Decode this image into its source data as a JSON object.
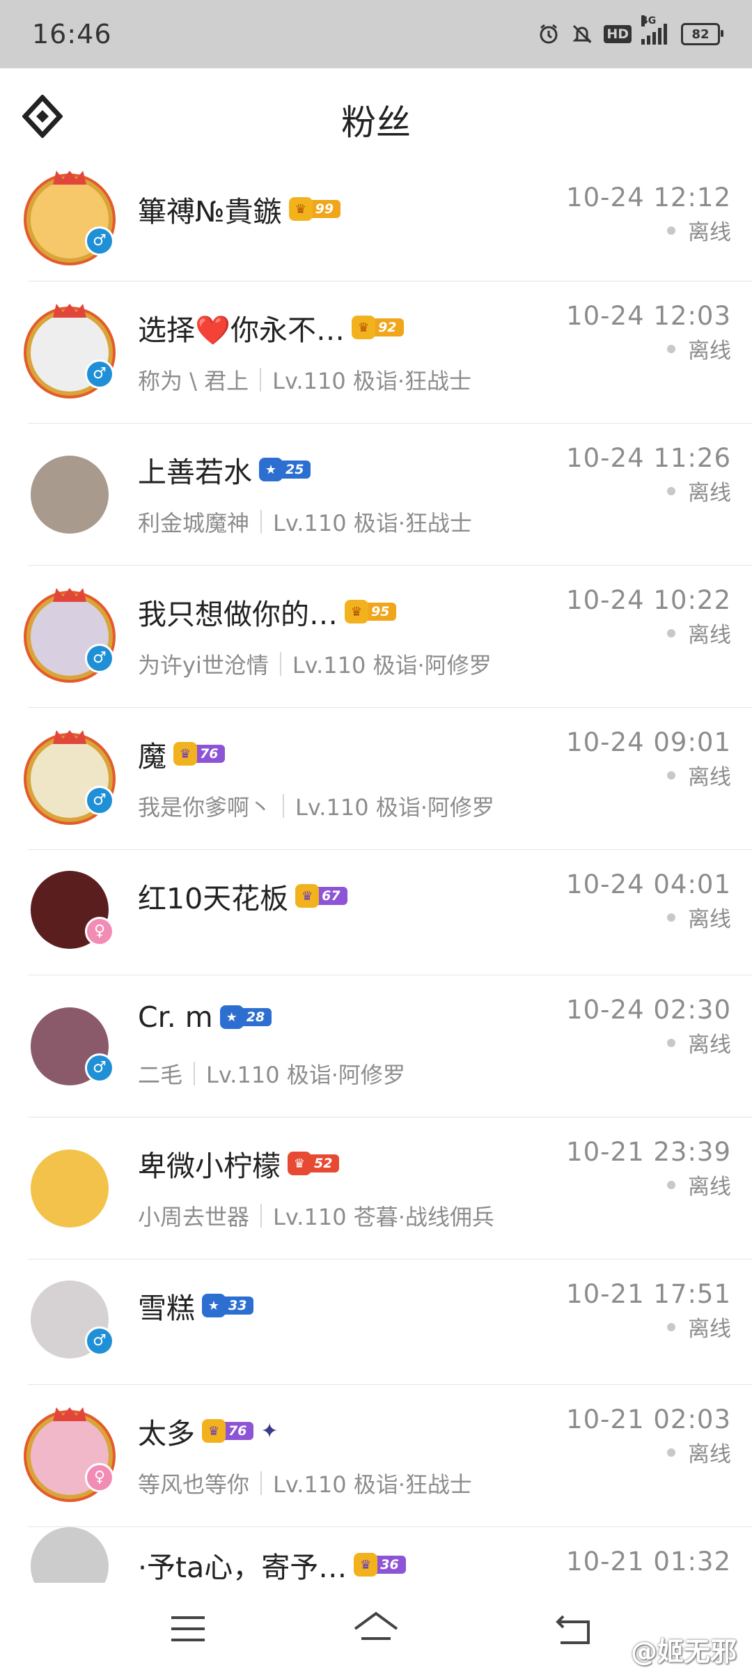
{
  "status_bar": {
    "time": "16:46",
    "network": "4G",
    "hd": "HD",
    "battery": "82"
  },
  "header": {
    "title": "粉丝"
  },
  "fans": [
    {
      "name": "篳禣№貴鏃",
      "level": "99",
      "badge_style": "gold",
      "sub_name": "",
      "game_info": "",
      "time": "10-24 12:12",
      "status": "离线",
      "gender": "♂",
      "gender_type": "male",
      "avatar_color": "#f6c86a",
      "frame": true
    },
    {
      "name": "选择❤️你永不…",
      "level": "92",
      "badge_style": "gold",
      "sub_name": "称为 \\ 君上",
      "game_info": "Lv.110 极诣·狂战士",
      "time": "10-24 12:03",
      "status": "离线",
      "gender": "♂",
      "gender_type": "male",
      "avatar_color": "#eeeeee",
      "frame": true
    },
    {
      "name": "上善若水",
      "level": "25",
      "badge_style": "blue",
      "sub_name": "利金城魔神",
      "game_info": "Lv.110 极诣·狂战士",
      "time": "10-24 11:26",
      "status": "离线",
      "gender": "",
      "gender_type": "",
      "avatar_color": "#a89a8c",
      "frame": false
    },
    {
      "name": "我只想做你的…",
      "level": "95",
      "badge_style": "gold",
      "sub_name": "为许yi世沧情",
      "game_info": "Lv.110 极诣·阿修罗",
      "time": "10-24 10:22",
      "status": "离线",
      "gender": "♂",
      "gender_type": "male",
      "avatar_color": "#d8d0e0",
      "frame": true
    },
    {
      "name": "魔",
      "level": "76",
      "badge_style": "purple",
      "sub_name": "我是你爹啊丶",
      "game_info": "Lv.110 极诣·阿修罗",
      "time": "10-24 09:01",
      "status": "离线",
      "gender": "♂",
      "gender_type": "male",
      "avatar_color": "#efe6c8",
      "frame": true
    },
    {
      "name": "红10天花板",
      "level": "67",
      "badge_style": "purple",
      "sub_name": "",
      "game_info": "",
      "time": "10-24 04:01",
      "status": "离线",
      "gender": "♀",
      "gender_type": "female",
      "avatar_color": "#5a1e1e",
      "frame": false
    },
    {
      "name": "Cr.  m",
      "level": "28",
      "badge_style": "blue",
      "sub_name": "二毛",
      "game_info": "Lv.110 极诣·阿修罗",
      "time": "10-24 02:30",
      "status": "离线",
      "gender": "♂",
      "gender_type": "male",
      "avatar_color": "#8a5a6a",
      "frame": false
    },
    {
      "name": "卑微小柠檬",
      "level": "52",
      "badge_style": "red",
      "sub_name": "小周去世器",
      "game_info": "Lv.110 苍暮·战线佣兵",
      "time": "10-21 23:39",
      "status": "离线",
      "gender": "",
      "gender_type": "",
      "avatar_color": "#f3c24a",
      "frame": false
    },
    {
      "name": "雪糕",
      "level": "33",
      "badge_style": "blue",
      "sub_name": "",
      "game_info": "",
      "time": "10-21 17:51",
      "status": "离线",
      "gender": "♂",
      "gender_type": "male",
      "avatar_color": "#d6d2d4",
      "frame": false
    },
    {
      "name": "太多",
      "level": "76",
      "badge_style": "purple",
      "sub_name": "等风也等你",
      "game_info": "Lv.110 极诣·狂战士",
      "time": "10-21 02:03",
      "status": "离线",
      "gender": "♀",
      "gender_type": "female",
      "avatar_color": "#f0b8c8",
      "frame": true,
      "extra_icon": "rank-emblem-icon"
    },
    {
      "name": "·予ta心，寄予…",
      "level": "36",
      "badge_style": "purple",
      "sub_name": "",
      "game_info": "",
      "time": "10-21 01:32",
      "status": "",
      "gender": "",
      "gender_type": "",
      "avatar_color": "#cccccc",
      "frame": false
    }
  ],
  "watermark": "@姬无邪",
  "colors": {
    "statusbar_bg": "#cfcfcf",
    "text_primary": "#222222",
    "text_secondary": "#8c8c8c",
    "divider": "#e6e6e6"
  }
}
